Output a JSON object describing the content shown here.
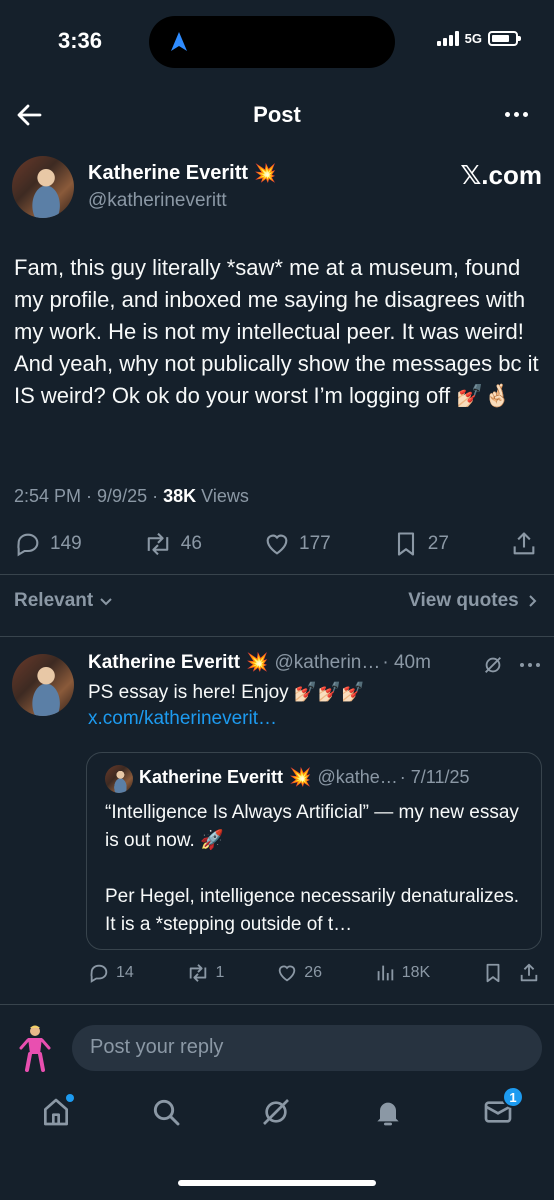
{
  "status_bar": {
    "time": "3:36",
    "network": "5G",
    "icons": [
      "location-arrow-icon",
      "signal-icon",
      "battery-icon"
    ]
  },
  "header": {
    "title": "Post",
    "back_icon": "arrow-left-icon",
    "more_icon": "more-horizontal-icon"
  },
  "post": {
    "author_name": "Katherine Everitt",
    "author_badge": "💥",
    "handle": "@katherineveritt",
    "source_label": "𝕏.com",
    "text": "Fam, this guy literally *saw* me at a museum, found my profile, and inboxed me saying he disagrees with my work. He is not my intellectual peer. It was weird! And yeah, why not publically show the messages bc it IS weird? Ok ok do your worst I’m logging off 💅🏻🤞🏻",
    "time": "2:54 PM",
    "date": "9/9/25",
    "views_count": "38K",
    "views_label": "Views",
    "stats": {
      "replies": "149",
      "reposts": "46",
      "likes": "177",
      "bookmarks": "27"
    }
  },
  "filters": {
    "sort_label": "Relevant",
    "view_quotes_label": "View quotes"
  },
  "reply": {
    "author_name": "Katherine Everitt",
    "author_badge": "💥",
    "handle": "@katherin…",
    "age": "· 40m",
    "text": "PS essay is here! Enjoy 💅🏻💅🏻💅🏻 ",
    "link": "x.com/katherineverit…",
    "quote": {
      "author_name": "Katherine Everitt",
      "author_badge": "💥",
      "handle": "@kathe…",
      "date": "· 7/11/25",
      "line1": "“Intelligence Is Always Artificial” — my new essay is out now. 🚀",
      "line2": "Per Hegel, intelligence necessarily denaturalizes. It is a *stepping outside of t…"
    },
    "stats": {
      "replies": "14",
      "reposts": "1",
      "likes": "26",
      "views": "18K"
    }
  },
  "composer": {
    "placeholder": "Post your reply"
  },
  "tabs": {
    "items": [
      "home-icon",
      "search-icon",
      "grok-icon",
      "notifications-icon",
      "messages-icon"
    ],
    "messages_badge": "1"
  },
  "colors": {
    "background": "#15202b",
    "accent": "#1d9bf0",
    "muted": "#8b98a5",
    "divider": "#38444d"
  }
}
